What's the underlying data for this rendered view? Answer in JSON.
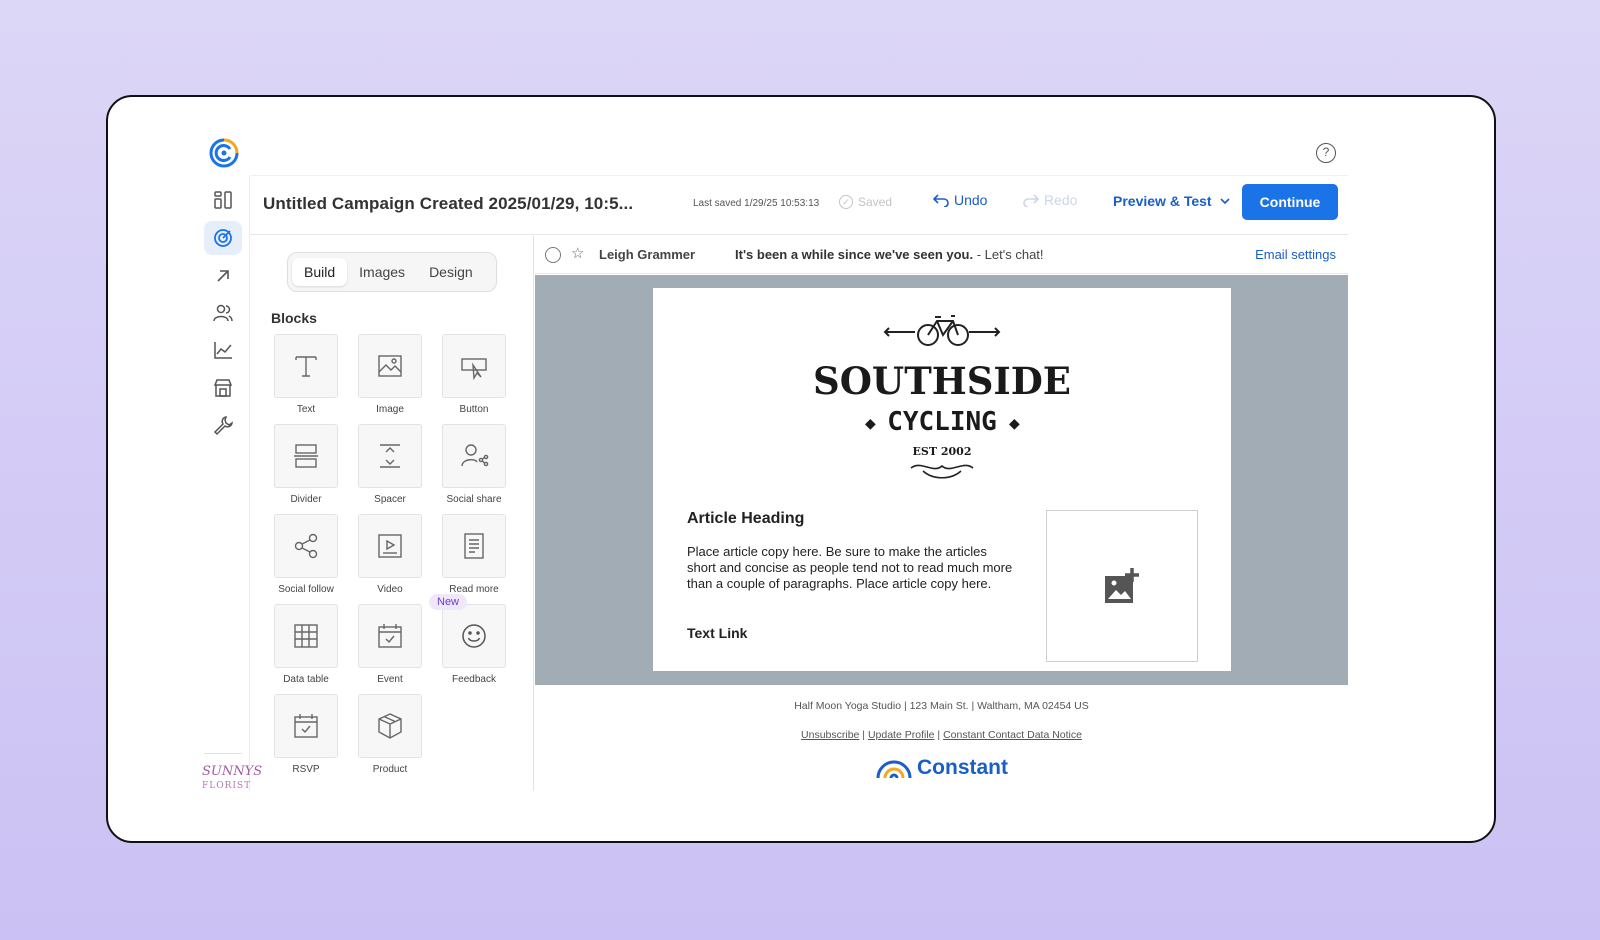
{
  "campaign": {
    "title": "Untitled Campaign Created 2025/01/29, 10:5...",
    "last_saved": "Last saved 1/29/25 10:53:13",
    "saved_label": "Saved"
  },
  "toolbar": {
    "undo_label": "Undo",
    "redo_label": "Redo",
    "preview_label": "Preview & Test",
    "continue_label": "Continue"
  },
  "help_label": "?",
  "sidebar": {
    "items": [
      {
        "icon": "dashboard-icon",
        "active": false
      },
      {
        "icon": "campaigns-icon",
        "active": true
      },
      {
        "icon": "arrow-up-right-icon",
        "active": false
      },
      {
        "icon": "contacts-icon",
        "active": false
      },
      {
        "icon": "reporting-icon",
        "active": false
      },
      {
        "icon": "store-icon",
        "active": false
      },
      {
        "icon": "tools-icon",
        "active": false
      }
    ],
    "brand_mini": "SUNNYS",
    "brand_mini_sub": "FLORIST"
  },
  "panel": {
    "tabs": [
      "Build",
      "Images",
      "Design"
    ],
    "active_tab": "Build",
    "blocks_title": "Blocks",
    "blocks": [
      {
        "label": "Text",
        "icon": "text-icon"
      },
      {
        "label": "Image",
        "icon": "image-icon"
      },
      {
        "label": "Button",
        "icon": "button-icon"
      },
      {
        "label": "Divider",
        "icon": "divider-icon"
      },
      {
        "label": "Spacer",
        "icon": "spacer-icon"
      },
      {
        "label": "Social share",
        "icon": "social-share-icon"
      },
      {
        "label": "Social follow",
        "icon": "social-follow-icon"
      },
      {
        "label": "Video",
        "icon": "video-icon"
      },
      {
        "label": "Read more",
        "icon": "read-more-icon"
      },
      {
        "label": "Data table",
        "icon": "data-table-icon"
      },
      {
        "label": "Event",
        "icon": "event-icon"
      },
      {
        "label": "Feedback",
        "icon": "feedback-icon"
      },
      {
        "label": "RSVP",
        "icon": "rsvp-icon"
      },
      {
        "label": "Product",
        "icon": "product-icon"
      }
    ],
    "new_badge": "New"
  },
  "envelope": {
    "sender": "Leigh Grammer",
    "subject": "It's been a while since we've seen you.",
    "preheader": " - Let's chat!",
    "settings_label": "Email settings"
  },
  "email_body": {
    "brand_line1": "SOUTHSIDE",
    "brand_line2": "CYCLING",
    "brand_est": "EST 2002",
    "article_heading": "Article Heading",
    "article_body": "Place article copy here. Be sure to make the articles short and concise as people tend not to read much more than a couple of paragraphs. Place article copy here.",
    "text_link": "Text Link"
  },
  "footer": {
    "address": "Half Moon Yoga Studio | 123 Main St. | Waltham, MA 02454 US",
    "links": [
      "Unsubscribe",
      "Update Profile",
      "Constant Contact Data Notice"
    ],
    "brand": "Constant"
  },
  "colors": {
    "accent": "#1b73e8",
    "link": "#1a5ec7",
    "canvas_gray": "#a2acb5",
    "background": "#cbc1f4"
  }
}
